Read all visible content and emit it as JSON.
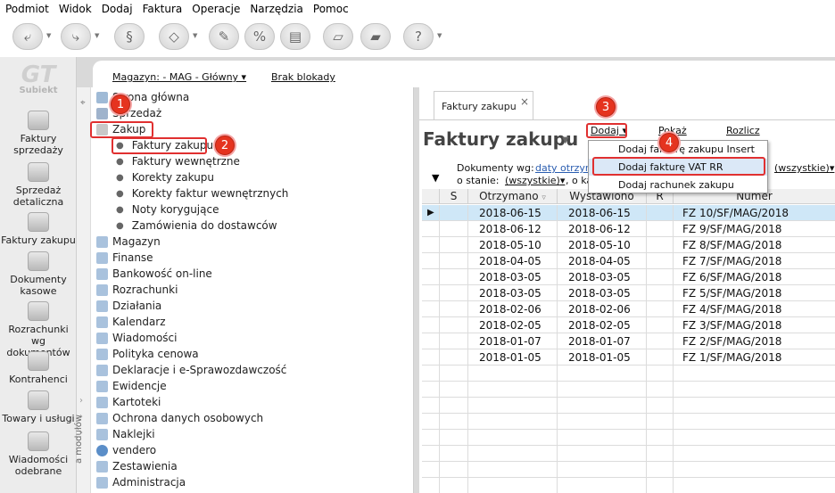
{
  "menubar": [
    "Podmiot",
    "Widok",
    "Dodaj",
    "Faktura",
    "Operacje",
    "Narzędzia",
    "Pomoc"
  ],
  "toolbar": {
    "buttons": [
      "back-icon",
      "forward-icon",
      "scan-icon",
      "tag-icon",
      "stamp-icon",
      "rebate-icon",
      "printer-icon",
      "ticket-icon",
      "ticket-alt-icon",
      "help-icon"
    ]
  },
  "logo": {
    "line1": "GT",
    "line2": "Subiekt"
  },
  "left_modules": [
    "Faktury sprzedaży",
    "Sprzedaż detaliczna",
    "Faktury zakupu",
    "Dokumenty kasowe",
    "Rozrachunki wg dokumentów",
    "Kontrahenci",
    "Towary i usługi",
    "Wiadomości odebrane"
  ],
  "infobar": {
    "magazyn": "Magazyn: - MAG - Główny",
    "blokady": "Brak blokady"
  },
  "nav": {
    "vertical_label": "a modułów",
    "items": [
      "Strona główna",
      "Sprzedaż",
      "Zakup",
      "Magazyn",
      "Finanse",
      "Bankowość on-line",
      "Rozrachunki",
      "Działania",
      "Kalendarz",
      "Wiadomości",
      "Polityka cenowa",
      "Deklaracje i e-Sprawozdawczość",
      "Ewidencje",
      "Kartoteki",
      "Ochrona danych osobowych",
      "Naklejki",
      "vendero",
      "Zestawienia",
      "Administracja"
    ],
    "sub_items": [
      "Faktury zakupu",
      "Faktury wewnętrzne",
      "Korekty zakupu",
      "Korekty faktur wewnętrznych",
      "Noty korygujące",
      "Zamówienia do dostawców"
    ]
  },
  "annotations": [
    "1",
    "2",
    "3",
    "4"
  ],
  "content": {
    "tab_label": "Faktury zakupu",
    "tab_close": "×",
    "title": "Faktury zakupu",
    "actions": {
      "dodaj": "Dodaj",
      "pokaz": "Pokaż",
      "rozlicz": "Rozlicz"
    },
    "filters": {
      "doc_label": "Dokumenty wg:",
      "doc_link": "daty otrzyma",
      "state_label": "o stanie:",
      "state_value": "(wszystkie)",
      "ka_label": ", o ka",
      "right_value": "(wszystkie)"
    }
  },
  "dropdown": {
    "items": [
      {
        "label": "Dodaj fakturę zakupu",
        "key": "Insert"
      },
      {
        "label": "Dodaj fakturę VAT RR",
        "key": ""
      },
      {
        "label": "Dodaj rachunek zakupu",
        "key": ""
      }
    ]
  },
  "grid": {
    "headers": [
      "S",
      "Otrzymano",
      "Wystawiono",
      "R",
      "Numer"
    ],
    "rows": [
      {
        "otrzymano": "2018-06-15",
        "wystawiono": "2018-06-15",
        "numer": "FZ 10/SF/MAG/2018"
      },
      {
        "otrzymano": "2018-06-12",
        "wystawiono": "2018-06-12",
        "numer": "FZ 9/SF/MAG/2018"
      },
      {
        "otrzymano": "2018-05-10",
        "wystawiono": "2018-05-10",
        "numer": "FZ 8/SF/MAG/2018"
      },
      {
        "otrzymano": "2018-04-05",
        "wystawiono": "2018-04-05",
        "numer": "FZ 7/SF/MAG/2018"
      },
      {
        "otrzymano": "2018-03-05",
        "wystawiono": "2018-03-05",
        "numer": "FZ 6/SF/MAG/2018"
      },
      {
        "otrzymano": "2018-03-05",
        "wystawiono": "2018-03-05",
        "numer": "FZ 5/SF/MAG/2018"
      },
      {
        "otrzymano": "2018-02-06",
        "wystawiono": "2018-02-06",
        "numer": "FZ 4/SF/MAG/2018"
      },
      {
        "otrzymano": "2018-02-05",
        "wystawiono": "2018-02-05",
        "numer": "FZ 3/SF/MAG/2018"
      },
      {
        "otrzymano": "2018-01-07",
        "wystawiono": "2018-01-07",
        "numer": "FZ 2/SF/MAG/2018"
      },
      {
        "otrzymano": "2018-01-05",
        "wystawiono": "2018-01-05",
        "numer": "FZ 1/SF/MAG/2018"
      }
    ]
  },
  "colors": {
    "highlight": "#e03030",
    "selected_row": "#cfe7f7",
    "link": "#2a5db0"
  }
}
